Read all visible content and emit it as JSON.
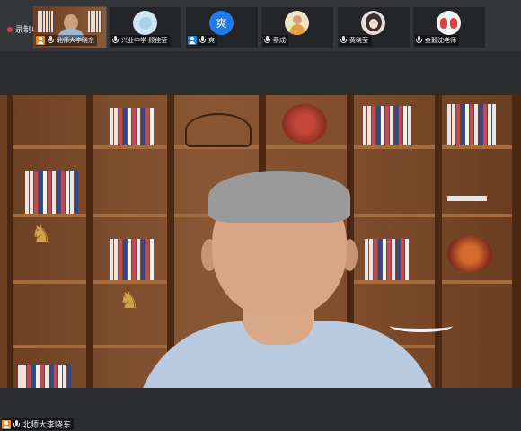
{
  "recording": {
    "label": "录制中"
  },
  "participants": [
    {
      "name": "北师大李晓东",
      "avatar_text": "",
      "avatar_color": "#5b4a3a",
      "badge": "orange"
    },
    {
      "name": "兴业中学 顾佳莹",
      "avatar_text": "",
      "avatar_color": "#cfe6f2",
      "badge": ""
    },
    {
      "name": "爽",
      "avatar_text": "爽",
      "avatar_color": "#1e7be8",
      "badge": "blue"
    },
    {
      "name": "蔡成",
      "avatar_text": "",
      "avatar_color": "#efe6c4",
      "badge": ""
    },
    {
      "name": "黄晓莹",
      "avatar_text": "",
      "avatar_color": "#e8ddd8",
      "badge": ""
    },
    {
      "name": "金毅沈老师",
      "avatar_text": "",
      "avatar_color": "#f4f4f4",
      "badge": ""
    }
  ],
  "main_video": {
    "speaker_name": "北师大李晓东"
  },
  "colors": {
    "accent_blue": "#1e88e5",
    "host_orange": "#ef8a1e",
    "record_red": "#e53935"
  }
}
